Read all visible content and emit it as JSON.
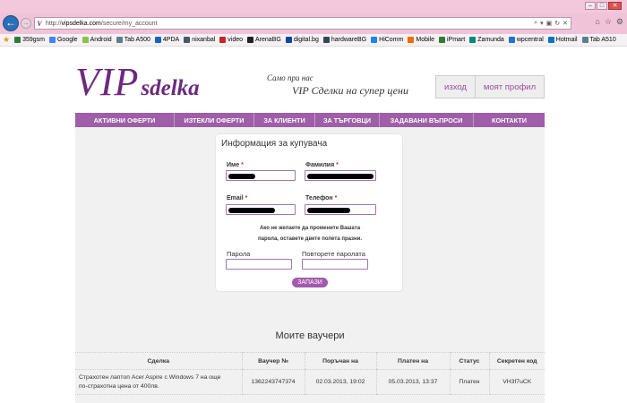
{
  "browser": {
    "url_prefix": "http://",
    "url_domain": "vipsdelka.com",
    "url_path": "/secure/my_account",
    "site_icon_text": "V",
    "favorites": [
      {
        "label": "359gsm",
        "color": "#2e7d32"
      },
      {
        "label": "Google",
        "color": "#4285f4"
      },
      {
        "label": "Android",
        "color": "#8bc34a"
      },
      {
        "label": "Tab A500",
        "color": "#607d8b"
      },
      {
        "label": "4PDA",
        "color": "#1565c0"
      },
      {
        "label": "nixanbal",
        "color": "#455a64"
      },
      {
        "label": "video",
        "color": "#c62828"
      },
      {
        "label": "ArenaBG",
        "color": "#212121"
      },
      {
        "label": "digital.bg",
        "color": "#0d47a1"
      },
      {
        "label": "hardwareBG",
        "color": "#37474f"
      },
      {
        "label": "HiComm",
        "color": "#1e88e5"
      },
      {
        "label": "Mobile",
        "color": "#ef6c00"
      },
      {
        "label": "iPmart",
        "color": "#2e7d32"
      },
      {
        "label": "Zamunda",
        "color": "#00897b"
      },
      {
        "label": "wpcentral",
        "color": "#1976d2"
      },
      {
        "label": "Hotmail",
        "color": "#0277bd"
      },
      {
        "label": "Tab A510",
        "color": "#607d8b"
      }
    ]
  },
  "header": {
    "logo_vip": "VIP",
    "logo_sdelka": "sdelka",
    "tagline_1": "Само при нас",
    "tagline_2": "VIP Сделки на супер цени",
    "logout_label": "изход",
    "profile_label": "моят профил"
  },
  "nav": {
    "items": [
      "АКТИВНИ ОФЕРТИ",
      "ИЗТЕКЛИ ОФЕРТИ",
      "ЗА КЛИЕНТИ",
      "ЗА ТЪРГОВЦИ",
      "ЗАДАВАНИ ВЪПРОСИ",
      "КОНТАКТИ"
    ]
  },
  "form": {
    "title": "Информация за купувача",
    "first_name_label": "Име",
    "last_name_label": "Фамилия",
    "email_label": "Email",
    "phone_label": "Телефон",
    "required_mark": "*",
    "note_line_1": "Ако не желаете да промените Вашата",
    "note_line_2": "парола, оставете двете полета празни.",
    "password_label": "Парола",
    "password_repeat_label": "Повторете паролата",
    "save_label": "ЗАПАЗИ"
  },
  "vouchers": {
    "title": "Моите ваучери",
    "columns": [
      "Сделка",
      "Ваучер №",
      "Поръчан на",
      "Платен на",
      "Статус",
      "Секретен код"
    ],
    "rows": [
      {
        "deal_line_1": "Страхотен лаптоп Acer Aspire с Windows 7 на още",
        "deal_line_2": "по-страхотна цена от 400лв.",
        "voucher_no": "1362243747374",
        "ordered_on": "02.03.2013, 19:02",
        "paid_on": "05.03.2013, 13:37",
        "status": "Платен",
        "secret_code": "VH3f7uCK"
      }
    ]
  }
}
